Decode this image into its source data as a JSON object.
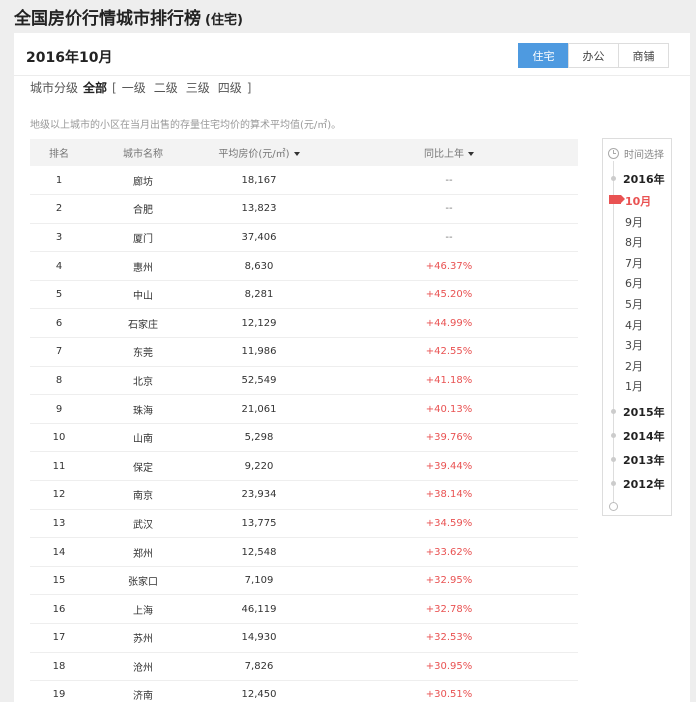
{
  "header": {
    "title": "全国房价行情城市排行榜",
    "subtitle": "(住宅)"
  },
  "panel": {
    "date": "2016年10月",
    "tabs": [
      {
        "label": "住宅",
        "active": true
      },
      {
        "label": "办公",
        "active": false
      },
      {
        "label": "商铺",
        "active": false
      }
    ]
  },
  "filter": {
    "label": "城市分级",
    "options": [
      "全部",
      "一级",
      "二级",
      "三级",
      "四级"
    ],
    "bracket_open": "[",
    "bracket_close": "]"
  },
  "note": "地级以上城市的小区在当月出售的存量住宅均价的算术平均值(元/㎡)。",
  "table": {
    "headers": {
      "rank": "排名",
      "city": "城市名称",
      "price": "平均房价(元/㎡)",
      "yoy": "同比上年"
    },
    "rows": [
      {
        "rank": "1",
        "city": "廊坊",
        "price": "18,167",
        "yoy": "--"
      },
      {
        "rank": "2",
        "city": "合肥",
        "price": "13,823",
        "yoy": "--"
      },
      {
        "rank": "3",
        "city": "厦门",
        "price": "37,406",
        "yoy": "--"
      },
      {
        "rank": "4",
        "city": "惠州",
        "price": "8,630",
        "yoy": "+46.37%"
      },
      {
        "rank": "5",
        "city": "中山",
        "price": "8,281",
        "yoy": "+45.20%"
      },
      {
        "rank": "6",
        "city": "石家庄",
        "price": "12,129",
        "yoy": "+44.99%"
      },
      {
        "rank": "7",
        "city": "东莞",
        "price": "11,986",
        "yoy": "+42.55%"
      },
      {
        "rank": "8",
        "city": "北京",
        "price": "52,549",
        "yoy": "+41.18%"
      },
      {
        "rank": "9",
        "city": "珠海",
        "price": "21,061",
        "yoy": "+40.13%"
      },
      {
        "rank": "10",
        "city": "山南",
        "price": "5,298",
        "yoy": "+39.76%"
      },
      {
        "rank": "11",
        "city": "保定",
        "price": "9,220",
        "yoy": "+39.44%"
      },
      {
        "rank": "12",
        "city": "南京",
        "price": "23,934",
        "yoy": "+38.14%"
      },
      {
        "rank": "13",
        "city": "武汉",
        "price": "13,775",
        "yoy": "+34.59%"
      },
      {
        "rank": "14",
        "city": "郑州",
        "price": "12,548",
        "yoy": "+33.62%"
      },
      {
        "rank": "15",
        "city": "张家口",
        "price": "7,109",
        "yoy": "+32.95%"
      },
      {
        "rank": "16",
        "city": "上海",
        "price": "46,119",
        "yoy": "+32.78%"
      },
      {
        "rank": "17",
        "city": "苏州",
        "price": "14,930",
        "yoy": "+32.53%"
      },
      {
        "rank": "18",
        "city": "沧州",
        "price": "7,826",
        "yoy": "+30.95%"
      },
      {
        "rank": "19",
        "city": "济南",
        "price": "12,450",
        "yoy": "+30.51%"
      }
    ]
  },
  "timeline": {
    "title": "时间选择",
    "items": [
      {
        "label": "2016年",
        "kind": "year"
      },
      {
        "label": "10月",
        "kind": "month",
        "active": true
      },
      {
        "label": "9月",
        "kind": "month"
      },
      {
        "label": "8月",
        "kind": "month"
      },
      {
        "label": "7月",
        "kind": "month"
      },
      {
        "label": "6月",
        "kind": "month"
      },
      {
        "label": "5月",
        "kind": "month"
      },
      {
        "label": "4月",
        "kind": "month"
      },
      {
        "label": "3月",
        "kind": "month"
      },
      {
        "label": "2月",
        "kind": "month"
      },
      {
        "label": "1月",
        "kind": "month"
      },
      {
        "label": "2015年",
        "kind": "year"
      },
      {
        "label": "2014年",
        "kind": "year"
      },
      {
        "label": "2013年",
        "kind": "year"
      },
      {
        "label": "2012年",
        "kind": "year"
      }
    ]
  },
  "colors": {
    "accent": "#4e9ae0",
    "increase": "#e95252"
  }
}
